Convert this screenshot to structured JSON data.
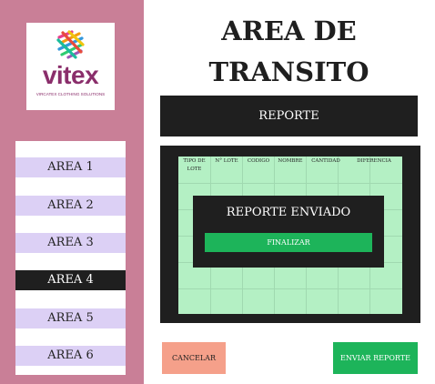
{
  "logo": {
    "word": "vitex",
    "subtitle": "VIRCATEX CLOTHING SOLUTIONS"
  },
  "sidebar": {
    "areas": [
      {
        "label": "AREA 1",
        "active": false
      },
      {
        "label": "AREA 2",
        "active": false
      },
      {
        "label": "AREA 3",
        "active": false
      },
      {
        "label": "AREA 4",
        "active": true
      },
      {
        "label": "AREA 5",
        "active": false
      },
      {
        "label": "AREA 6",
        "active": false
      }
    ]
  },
  "page": {
    "title_line1": "AREA DE",
    "title_line2": "TRANSITO"
  },
  "report_bar": {
    "label": "REPORTE"
  },
  "table": {
    "columns": [
      "TIPO DE LOTE",
      "N° LOTE",
      "CODIGO",
      "NOMBRE",
      "CANTIDAD",
      "DIFERENCIA"
    ]
  },
  "modal": {
    "title": "REPORTE ENVIADO",
    "button": "FINALIZAR"
  },
  "actions": {
    "cancel": "CANCELAR",
    "send": "ENVIAR REPORTE"
  },
  "colors": {
    "sidebar": "#c97f97",
    "area_item": "#dcd0f5",
    "dark": "#1f1f1f",
    "table_bg": "#b4f0c4",
    "green": "#1db45a",
    "cancel": "#f5a08a"
  }
}
